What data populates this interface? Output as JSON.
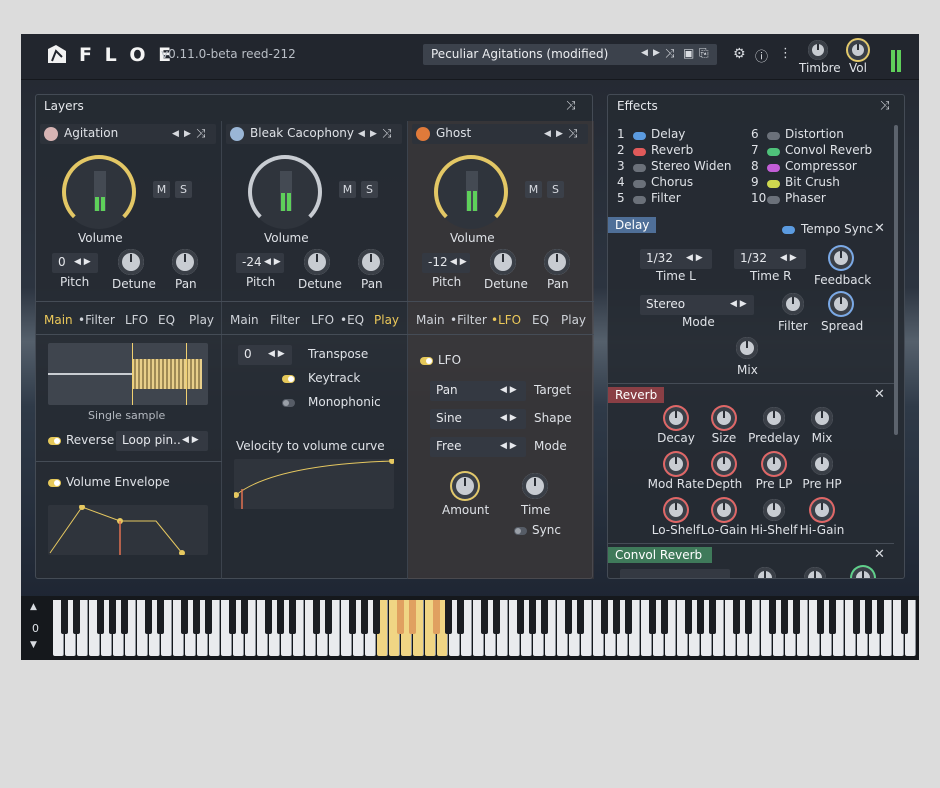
{
  "topbar": {
    "logo_text": "F L O E",
    "version": "v0.11.0-beta reed-212",
    "preset_name": "Peculiar Agitations (modified)",
    "timbre_label": "Timbre",
    "vol_label": "Vol",
    "icons": [
      "prev-arrow-icon",
      "next-arrow-icon",
      "shuffle-icon",
      "save-icon",
      "save-as-icon",
      "gear-icon",
      "info-icon",
      "more-icon"
    ]
  },
  "layers": {
    "title": "Layers",
    "items": [
      {
        "name": "Agitation",
        "volume_label": "Volume",
        "m": "M",
        "s": "S",
        "pitch_value": "0",
        "pitch_label": "Pitch",
        "detune_label": "Detune",
        "pan_label": "Pan",
        "tabs": [
          "Main",
          "•Filter",
          "LFO",
          "EQ",
          "Play"
        ],
        "active_tab": "Main"
      },
      {
        "name": "Bleak Cacophony",
        "volume_label": "Volume",
        "m": "M",
        "s": "S",
        "pitch_value": "-24",
        "pitch_label": "Pitch",
        "detune_label": "Detune",
        "pan_label": "Pan",
        "tabs": [
          "Main",
          "Filter",
          "LFO",
          "•EQ",
          "Play"
        ],
        "active_tab": "Play"
      },
      {
        "name": "Ghost",
        "volume_label": "Volume",
        "m": "M",
        "s": "S",
        "pitch_value": "-12",
        "pitch_label": "Pitch",
        "detune_label": "Detune",
        "pan_label": "Pan",
        "tabs": [
          "Main",
          "•Filter",
          "•LFO",
          "EQ",
          "Play"
        ],
        "active_tab": "•LFO"
      }
    ],
    "layer1_main": {
      "sample_label": "Single sample",
      "reverse_label": "Reverse",
      "loop_value": "Loop pin..",
      "envelope_label": "Volume Envelope"
    },
    "layer2_play": {
      "transpose_value": "0",
      "transpose_label": "Transpose",
      "keytrack_label": "Keytrack",
      "monophonic_label": "Monophonic",
      "velocity_label": "Velocity to volume curve"
    },
    "layer3_lfo": {
      "lfo_label": "LFO",
      "target_value": "Pan",
      "target_label": "Target",
      "shape_value": "Sine",
      "shape_label": "Shape",
      "mode_value": "Free",
      "mode_label": "Mode",
      "amount_label": "Amount",
      "time_label": "Time",
      "sync_label": "Sync"
    }
  },
  "effects": {
    "title": "Effects",
    "list": [
      {
        "num": "1",
        "name": "Delay",
        "color": "#5b9be0"
      },
      {
        "num": "2",
        "name": "Reverb",
        "color": "#e05a5a"
      },
      {
        "num": "3",
        "name": "Stereo Widen",
        "color": "#6b717a"
      },
      {
        "num": "4",
        "name": "Chorus",
        "color": "#6b717a"
      },
      {
        "num": "5",
        "name": "Filter",
        "color": "#6b717a"
      },
      {
        "num": "6",
        "name": "Distortion",
        "color": "#6b717a"
      },
      {
        "num": "7",
        "name": "Convol Reverb",
        "color": "#4fc27a"
      },
      {
        "num": "8",
        "name": "Compressor",
        "color": "#c35ed8"
      },
      {
        "num": "9",
        "name": "Bit Crush",
        "color": "#cfd84f"
      },
      {
        "num": "10",
        "name": "Phaser",
        "color": "#6b717a"
      }
    ],
    "delay": {
      "title": "Delay",
      "tempo_sync_label": "Tempo Sync",
      "time_l_value": "1/32",
      "time_l_label": "Time L",
      "time_r_value": "1/32",
      "time_r_label": "Time R",
      "feedback_label": "Feedback",
      "mode_value": "Stereo",
      "mode_label": "Mode",
      "filter_label": "Filter",
      "spread_label": "Spread",
      "mix_label": "Mix"
    },
    "reverb": {
      "title": "Reverb",
      "knobs_row1": [
        "Decay",
        "Size",
        "Predelay",
        "Mix"
      ],
      "knobs_row2": [
        "Mod Rate",
        "Depth",
        "Pre LP",
        "Pre HP"
      ],
      "knobs_row3": [
        "Lo-Shelf",
        "Lo-Gain",
        "Hi-Shelf",
        "Hi-Gain"
      ]
    },
    "convol": {
      "title": "Convol Reverb"
    }
  },
  "keyboard": {
    "octave_value": "0"
  }
}
